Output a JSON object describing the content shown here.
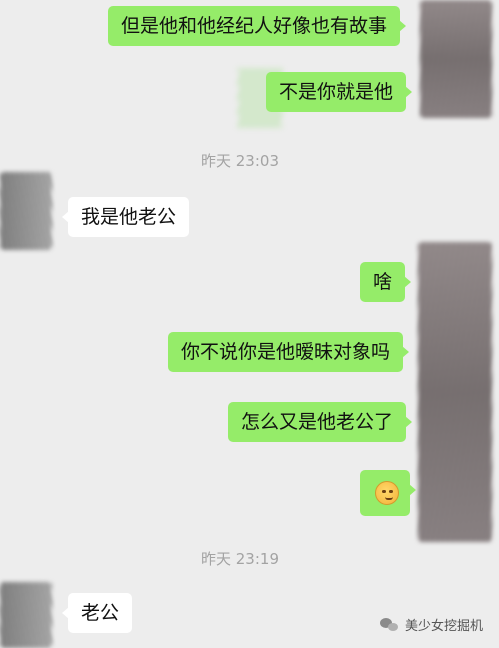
{
  "messages": [
    {
      "side": "me",
      "text": "但是他和他经纪人好像也有故事"
    },
    {
      "side": "me",
      "text": "不是你就是他"
    },
    {
      "side": "other",
      "text": "我是他老公"
    },
    {
      "side": "me",
      "text": "啥"
    },
    {
      "side": "me",
      "text": "你不说你是他暧昧对象吗"
    },
    {
      "side": "me",
      "text": "怎么又是他老公了"
    },
    {
      "side": "me",
      "emoji": "thinking-face-emoji"
    },
    {
      "side": "other",
      "text": "老公"
    }
  ],
  "timestamps": [
    "昨天 23:03",
    "昨天 23:19"
  ],
  "watermark": "美少女挖掘机",
  "colors": {
    "background": "#ededed",
    "my_bubble": "#95ec69",
    "other_bubble": "#ffffff",
    "timestamp": "#a3a3a3"
  }
}
